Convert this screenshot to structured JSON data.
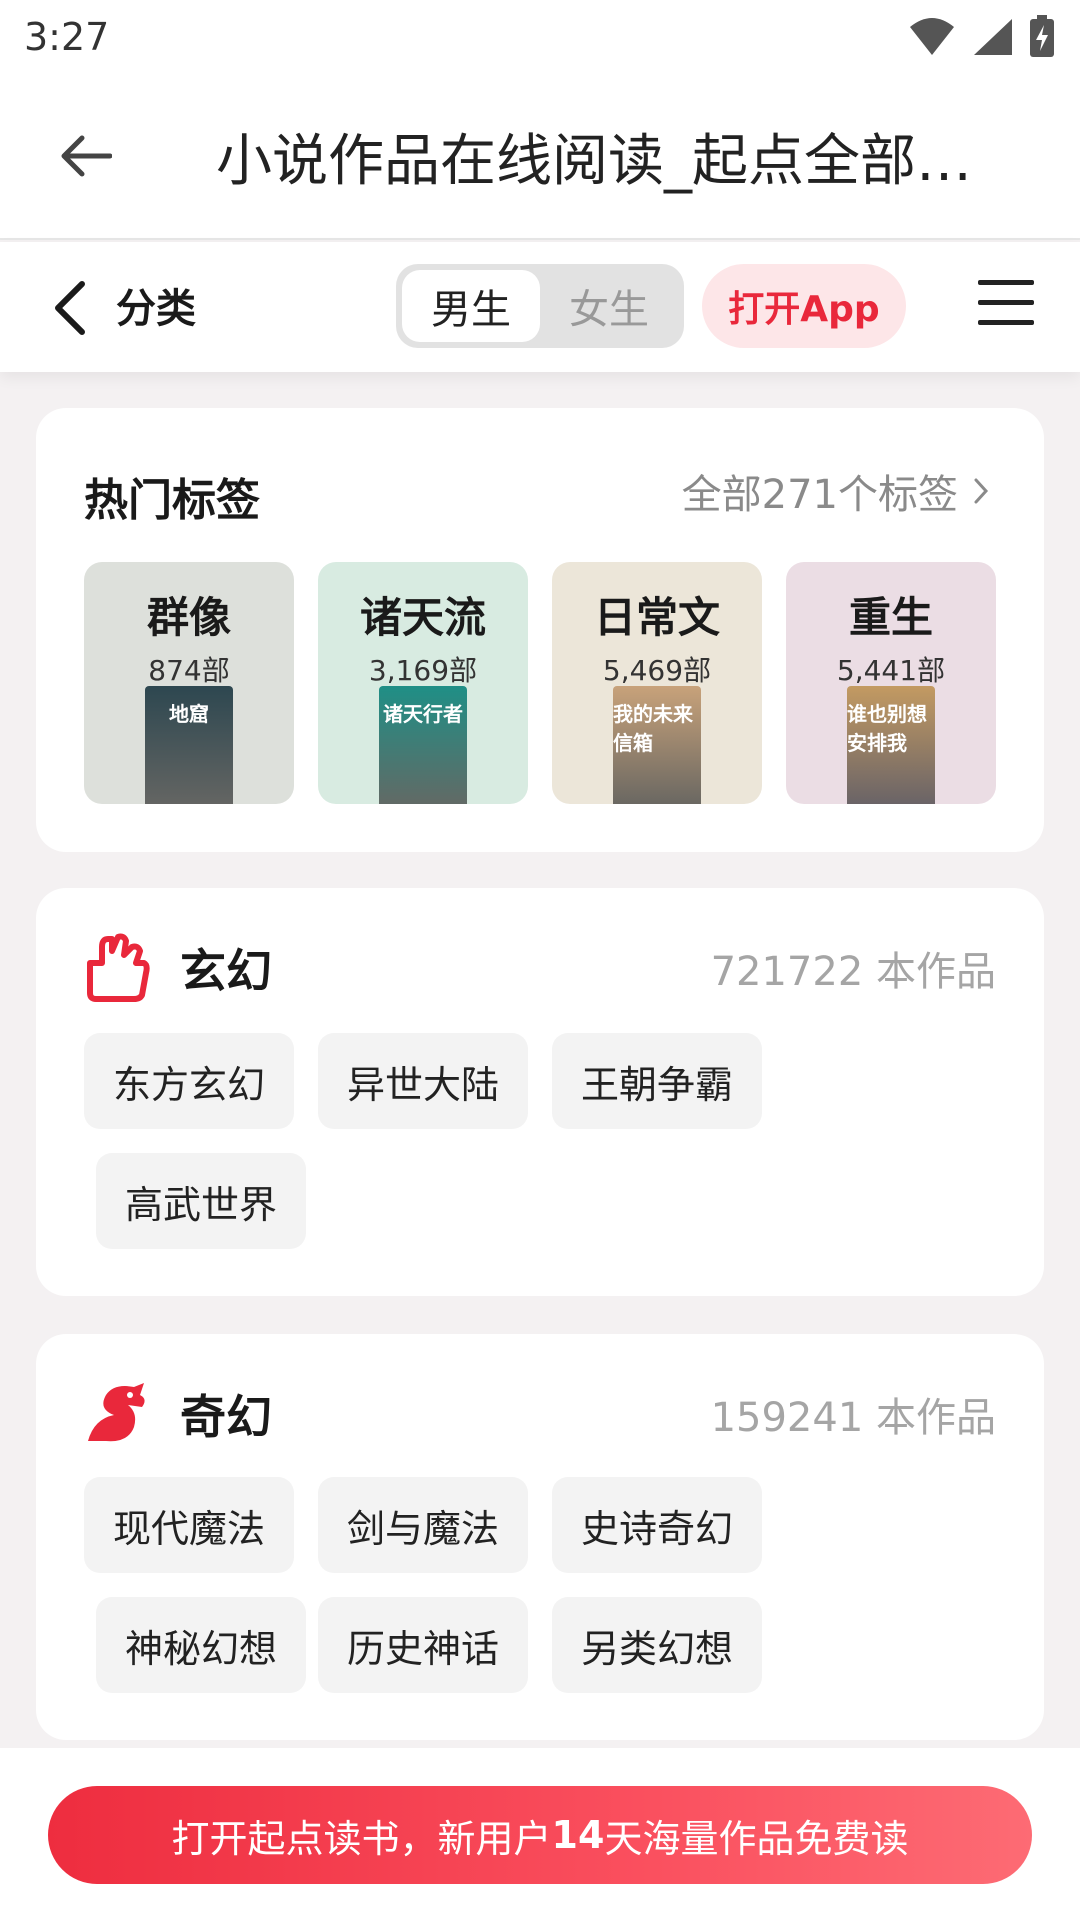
{
  "status_bar": {
    "time": "3:27"
  },
  "browser": {
    "title": "小说作品在线阅读_起点全部…"
  },
  "header": {
    "title": "分类",
    "gender_options": [
      "男生",
      "女生"
    ],
    "active_gender": "男生",
    "open_app_label": "打开App"
  },
  "hot_tags": {
    "title": "热门标签",
    "all_link": "全部271个标签",
    "tags": [
      {
        "name": "群像",
        "count": "874部",
        "bg": "#dde0db",
        "cover_title": "地窟",
        "cover_color": "#2d4750"
      },
      {
        "name": "诸天流",
        "count": "3,169部",
        "bg": "#d8ebe1",
        "cover_title": "诸天行者",
        "cover_color": "#1f8f86"
      },
      {
        "name": "日常文",
        "count": "5,469部",
        "bg": "#ece6d9",
        "cover_title": "我的未来信箱",
        "cover_color": "#c8a27a"
      },
      {
        "name": "重生",
        "count": "5,441部",
        "bg": "#ebdde4",
        "cover_title": "谁也别想安排我",
        "cover_color": "#c39a62"
      }
    ]
  },
  "categories": [
    {
      "name": "玄幻",
      "count": "721722 本作品",
      "icon": "fist-icon",
      "subtags": [
        "东方玄幻",
        "异世大陆",
        "王朝争霸",
        "高武世界"
      ]
    },
    {
      "name": "奇幻",
      "count": "159241 本作品",
      "icon": "dragon-icon",
      "subtags": [
        "现代魔法",
        "剑与魔法",
        "史诗奇幻",
        "神秘幻想",
        "历史神话",
        "另类幻想"
      ]
    }
  ],
  "bottom_cta": {
    "prefix": "打开起点读书，新用户",
    "highlight": "14",
    "suffix": "天海量作品免费读"
  },
  "colors": {
    "accent": "#e9283b",
    "accent_light": "#fde6e8"
  }
}
